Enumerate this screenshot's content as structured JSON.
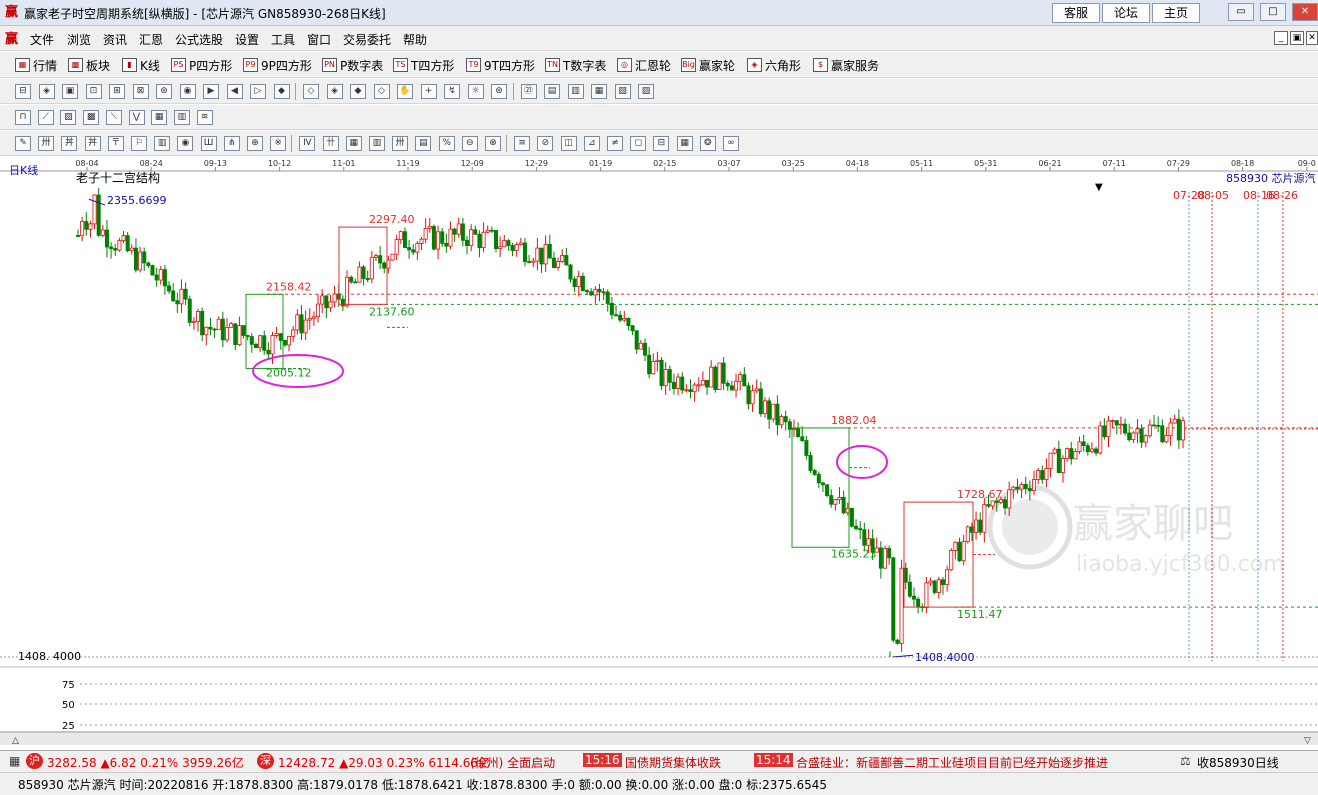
{
  "window": {
    "title": "赢家老子时空周期系统[纵横版] - [芯片源汽  GN858930-268日K线]",
    "app_icon": "赢",
    "links": [
      "客服",
      "论坛",
      "主页"
    ],
    "controls": [
      "▭",
      "□",
      "✕"
    ]
  },
  "menu": {
    "icon": "赢",
    "items": [
      "文件",
      "浏览",
      "资讯",
      "汇恩",
      "公式选股",
      "设置",
      "工具",
      "窗口",
      "交易委托",
      "帮助"
    ],
    "mdi": [
      "_",
      "▣",
      "✕"
    ]
  },
  "toolbar1": [
    {
      "icon": "▦",
      "label": "行情"
    },
    {
      "icon": "▩",
      "label": "板块"
    },
    {
      "icon": "▮",
      "label": "K线"
    },
    {
      "icon": "PS",
      "label": "P四方形"
    },
    {
      "icon": "P9",
      "label": "9P四方形"
    },
    {
      "icon": "PN",
      "label": "P数字表"
    },
    {
      "icon": "TS",
      "label": "T四方形"
    },
    {
      "icon": "T9",
      "label": "9T四方形"
    },
    {
      "icon": "TN",
      "label": "T数字表"
    },
    {
      "icon": "◎",
      "label": "汇恩轮"
    },
    {
      "icon": "Big",
      "label": "赢家轮"
    },
    {
      "icon": "◈",
      "label": "六角形"
    },
    {
      "icon": "$",
      "label": "赢家服务"
    }
  ],
  "chart": {
    "period_label": "日K线",
    "indicator_name": "老子十二宫结构",
    "code_name": "858930  芯片源汽",
    "price_axis_label": "1408. 4000",
    "date_ticks": [
      "08-04",
      "08-24",
      "09-13",
      "10-12",
      "11-01",
      "11-19",
      "12-09",
      "12-29",
      "01-19",
      "02-15",
      "03-07",
      "03-25",
      "04-18",
      "05-11",
      "05-31",
      "06-21",
      "07-11",
      "07-29",
      "08-18",
      "09-0"
    ],
    "future_dates": [
      "07-28",
      "08-05",
      "08-16",
      "08-26"
    ],
    "price_labels": [
      {
        "text": "2355.6699",
        "price": 2355.67
      },
      {
        "text": "2297.40",
        "price": 2297.4
      },
      {
        "text": "2158.42",
        "price": 2158.42
      },
      {
        "text": "2137.60",
        "price": 2137.6
      },
      {
        "text": "2005.12",
        "price": 2005.12
      },
      {
        "text": "1882.04",
        "price": 1882.04
      },
      {
        "text": "1728.67",
        "price": 1728.67
      },
      {
        "text": "1635.23",
        "price": 1635.23
      },
      {
        "text": "1511.47",
        "price": 1511.47
      },
      {
        "text": "1408.4000",
        "price": 1408.4
      }
    ],
    "sub_ticks": [
      "75",
      "50",
      "25"
    ],
    "watermark": {
      "title": "赢家聊吧",
      "url": "liaoba.yjcf360.com"
    }
  },
  "chart_data": {
    "type": "candlestick",
    "title": "芯片源汽  GN858930-268日K线",
    "x_dates": [
      "08-04",
      "08-24",
      "09-13",
      "10-12",
      "11-01",
      "11-19",
      "12-09",
      "12-29",
      "01-19",
      "02-15",
      "03-07",
      "03-25",
      "04-18",
      "05-11",
      "05-31",
      "06-21",
      "07-11",
      "07-29"
    ],
    "close_approx": [
      2330,
      2220,
      2090,
      2060,
      2150,
      2270,
      2280,
      2250,
      2170,
      1980,
      1990,
      1870,
      1660,
      1530,
      1710,
      1810,
      1880,
      1879
    ],
    "high": 2355.67,
    "low": 1408.4,
    "ylim": [
      1400,
      2370
    ],
    "levels": [
      2158.42,
      2137.6,
      1882.04,
      1511.47,
      1408.4
    ]
  },
  "status": {
    "sh_icon": "沪",
    "sh_text": "3282.58 ▲6.82 0.21% 3959.26亿",
    "sz_icon": "深",
    "sz_text": "12428.72 ▲29.03 0.23% 6114.66亿",
    "news1": "(徐州) 全面启动",
    "news2_time": "15:16",
    "news2": "国债期货集体收跌",
    "news3_time": "15:14",
    "news3": "合盛硅业：新疆鄯善二期工业硅项目目前已经开始逐步推进",
    "right": "收858930日线"
  },
  "info": {
    "text": "858930  芯片源汽  时间:20220816  开:1878.8300  高:1879.0178  低:1878.6421  收:1878.8300  手:0  额:0.00  换:0.00  涨:0.00  盘:0  标:2375.6545"
  }
}
